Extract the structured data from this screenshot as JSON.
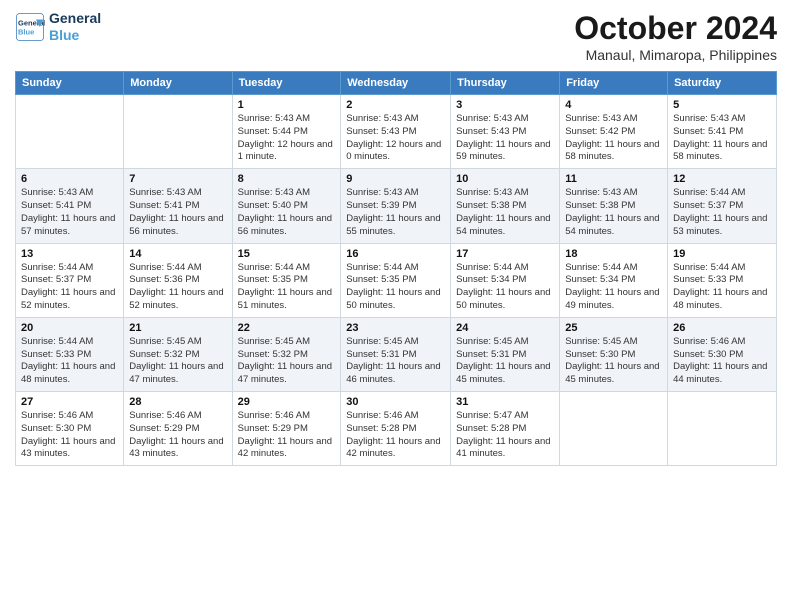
{
  "logo": {
    "line1": "General",
    "line2": "Blue",
    "icon_color": "#4a9fd4"
  },
  "title": "October 2024",
  "location": "Manaul, Mimaropa, Philippines",
  "headers": [
    "Sunday",
    "Monday",
    "Tuesday",
    "Wednesday",
    "Thursday",
    "Friday",
    "Saturday"
  ],
  "weeks": [
    [
      {
        "day": "",
        "sunrise": "",
        "sunset": "",
        "daylight": ""
      },
      {
        "day": "",
        "sunrise": "",
        "sunset": "",
        "daylight": ""
      },
      {
        "day": "1",
        "sunrise": "Sunrise: 5:43 AM",
        "sunset": "Sunset: 5:44 PM",
        "daylight": "Daylight: 12 hours and 1 minute."
      },
      {
        "day": "2",
        "sunrise": "Sunrise: 5:43 AM",
        "sunset": "Sunset: 5:43 PM",
        "daylight": "Daylight: 12 hours and 0 minutes."
      },
      {
        "day": "3",
        "sunrise": "Sunrise: 5:43 AM",
        "sunset": "Sunset: 5:43 PM",
        "daylight": "Daylight: 11 hours and 59 minutes."
      },
      {
        "day": "4",
        "sunrise": "Sunrise: 5:43 AM",
        "sunset": "Sunset: 5:42 PM",
        "daylight": "Daylight: 11 hours and 58 minutes."
      },
      {
        "day": "5",
        "sunrise": "Sunrise: 5:43 AM",
        "sunset": "Sunset: 5:41 PM",
        "daylight": "Daylight: 11 hours and 58 minutes."
      }
    ],
    [
      {
        "day": "6",
        "sunrise": "Sunrise: 5:43 AM",
        "sunset": "Sunset: 5:41 PM",
        "daylight": "Daylight: 11 hours and 57 minutes."
      },
      {
        "day": "7",
        "sunrise": "Sunrise: 5:43 AM",
        "sunset": "Sunset: 5:41 PM",
        "daylight": "Daylight: 11 hours and 56 minutes."
      },
      {
        "day": "8",
        "sunrise": "Sunrise: 5:43 AM",
        "sunset": "Sunset: 5:40 PM",
        "daylight": "Daylight: 11 hours and 56 minutes."
      },
      {
        "day": "9",
        "sunrise": "Sunrise: 5:43 AM",
        "sunset": "Sunset: 5:39 PM",
        "daylight": "Daylight: 11 hours and 55 minutes."
      },
      {
        "day": "10",
        "sunrise": "Sunrise: 5:43 AM",
        "sunset": "Sunset: 5:38 PM",
        "daylight": "Daylight: 11 hours and 54 minutes."
      },
      {
        "day": "11",
        "sunrise": "Sunrise: 5:43 AM",
        "sunset": "Sunset: 5:38 PM",
        "daylight": "Daylight: 11 hours and 54 minutes."
      },
      {
        "day": "12",
        "sunrise": "Sunrise: 5:44 AM",
        "sunset": "Sunset: 5:37 PM",
        "daylight": "Daylight: 11 hours and 53 minutes."
      }
    ],
    [
      {
        "day": "13",
        "sunrise": "Sunrise: 5:44 AM",
        "sunset": "Sunset: 5:37 PM",
        "daylight": "Daylight: 11 hours and 52 minutes."
      },
      {
        "day": "14",
        "sunrise": "Sunrise: 5:44 AM",
        "sunset": "Sunset: 5:36 PM",
        "daylight": "Daylight: 11 hours and 52 minutes."
      },
      {
        "day": "15",
        "sunrise": "Sunrise: 5:44 AM",
        "sunset": "Sunset: 5:35 PM",
        "daylight": "Daylight: 11 hours and 51 minutes."
      },
      {
        "day": "16",
        "sunrise": "Sunrise: 5:44 AM",
        "sunset": "Sunset: 5:35 PM",
        "daylight": "Daylight: 11 hours and 50 minutes."
      },
      {
        "day": "17",
        "sunrise": "Sunrise: 5:44 AM",
        "sunset": "Sunset: 5:34 PM",
        "daylight": "Daylight: 11 hours and 50 minutes."
      },
      {
        "day": "18",
        "sunrise": "Sunrise: 5:44 AM",
        "sunset": "Sunset: 5:34 PM",
        "daylight": "Daylight: 11 hours and 49 minutes."
      },
      {
        "day": "19",
        "sunrise": "Sunrise: 5:44 AM",
        "sunset": "Sunset: 5:33 PM",
        "daylight": "Daylight: 11 hours and 48 minutes."
      }
    ],
    [
      {
        "day": "20",
        "sunrise": "Sunrise: 5:44 AM",
        "sunset": "Sunset: 5:33 PM",
        "daylight": "Daylight: 11 hours and 48 minutes."
      },
      {
        "day": "21",
        "sunrise": "Sunrise: 5:45 AM",
        "sunset": "Sunset: 5:32 PM",
        "daylight": "Daylight: 11 hours and 47 minutes."
      },
      {
        "day": "22",
        "sunrise": "Sunrise: 5:45 AM",
        "sunset": "Sunset: 5:32 PM",
        "daylight": "Daylight: 11 hours and 47 minutes."
      },
      {
        "day": "23",
        "sunrise": "Sunrise: 5:45 AM",
        "sunset": "Sunset: 5:31 PM",
        "daylight": "Daylight: 11 hours and 46 minutes."
      },
      {
        "day": "24",
        "sunrise": "Sunrise: 5:45 AM",
        "sunset": "Sunset: 5:31 PM",
        "daylight": "Daylight: 11 hours and 45 minutes."
      },
      {
        "day": "25",
        "sunrise": "Sunrise: 5:45 AM",
        "sunset": "Sunset: 5:30 PM",
        "daylight": "Daylight: 11 hours and 45 minutes."
      },
      {
        "day": "26",
        "sunrise": "Sunrise: 5:46 AM",
        "sunset": "Sunset: 5:30 PM",
        "daylight": "Daylight: 11 hours and 44 minutes."
      }
    ],
    [
      {
        "day": "27",
        "sunrise": "Sunrise: 5:46 AM",
        "sunset": "Sunset: 5:30 PM",
        "daylight": "Daylight: 11 hours and 43 minutes."
      },
      {
        "day": "28",
        "sunrise": "Sunrise: 5:46 AM",
        "sunset": "Sunset: 5:29 PM",
        "daylight": "Daylight: 11 hours and 43 minutes."
      },
      {
        "day": "29",
        "sunrise": "Sunrise: 5:46 AM",
        "sunset": "Sunset: 5:29 PM",
        "daylight": "Daylight: 11 hours and 42 minutes."
      },
      {
        "day": "30",
        "sunrise": "Sunrise: 5:46 AM",
        "sunset": "Sunset: 5:28 PM",
        "daylight": "Daylight: 11 hours and 42 minutes."
      },
      {
        "day": "31",
        "sunrise": "Sunrise: 5:47 AM",
        "sunset": "Sunset: 5:28 PM",
        "daylight": "Daylight: 11 hours and 41 minutes."
      },
      {
        "day": "",
        "sunrise": "",
        "sunset": "",
        "daylight": ""
      },
      {
        "day": "",
        "sunrise": "",
        "sunset": "",
        "daylight": ""
      }
    ]
  ]
}
